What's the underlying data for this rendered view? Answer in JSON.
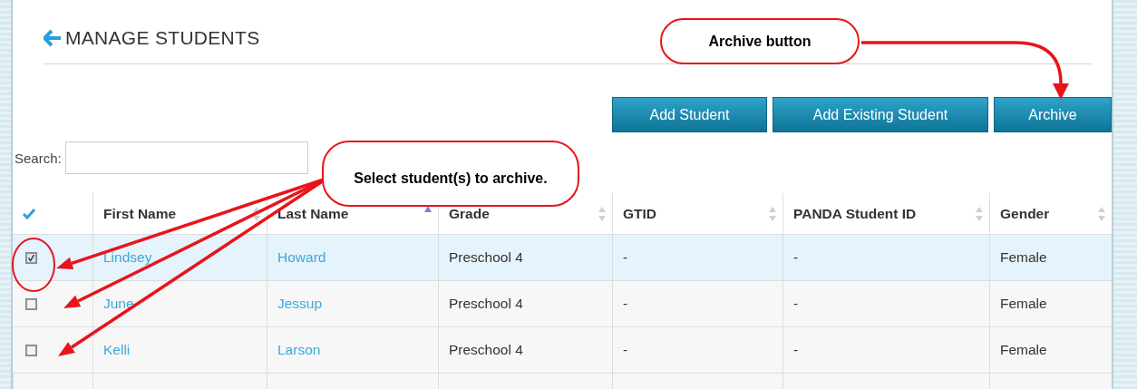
{
  "page": {
    "title": "MANAGE STUDENTS"
  },
  "buttons": [
    "Add Student",
    "Add Existing Student",
    "Archive"
  ],
  "search": {
    "label": "Search:"
  },
  "table": {
    "columns": [
      {
        "label": "First Name",
        "sorted": false
      },
      {
        "label": "Last Name",
        "sorted": true
      },
      {
        "label": "Grade",
        "sorted": false
      },
      {
        "label": "GTID",
        "sorted": false
      },
      {
        "label": "PANDA Student ID",
        "sorted": false
      },
      {
        "label": "Gender",
        "sorted": false
      }
    ],
    "rows": [
      {
        "checked": true,
        "selected": true,
        "cells": [
          "Lindsey",
          "Howard",
          "Preschool 4",
          "-",
          "-",
          "Female"
        ]
      },
      {
        "checked": false,
        "selected": false,
        "cells": [
          "June",
          "Jessup",
          "Preschool 4",
          "-",
          "-",
          "Female"
        ]
      },
      {
        "checked": false,
        "selected": false,
        "cells": [
          "Kelli",
          "Larson",
          "Preschool 4",
          "-",
          "-",
          "Female"
        ]
      }
    ]
  },
  "callouts": [
    {
      "text": "Archive button"
    },
    {
      "text": "Select student(s) to archive."
    }
  ]
}
